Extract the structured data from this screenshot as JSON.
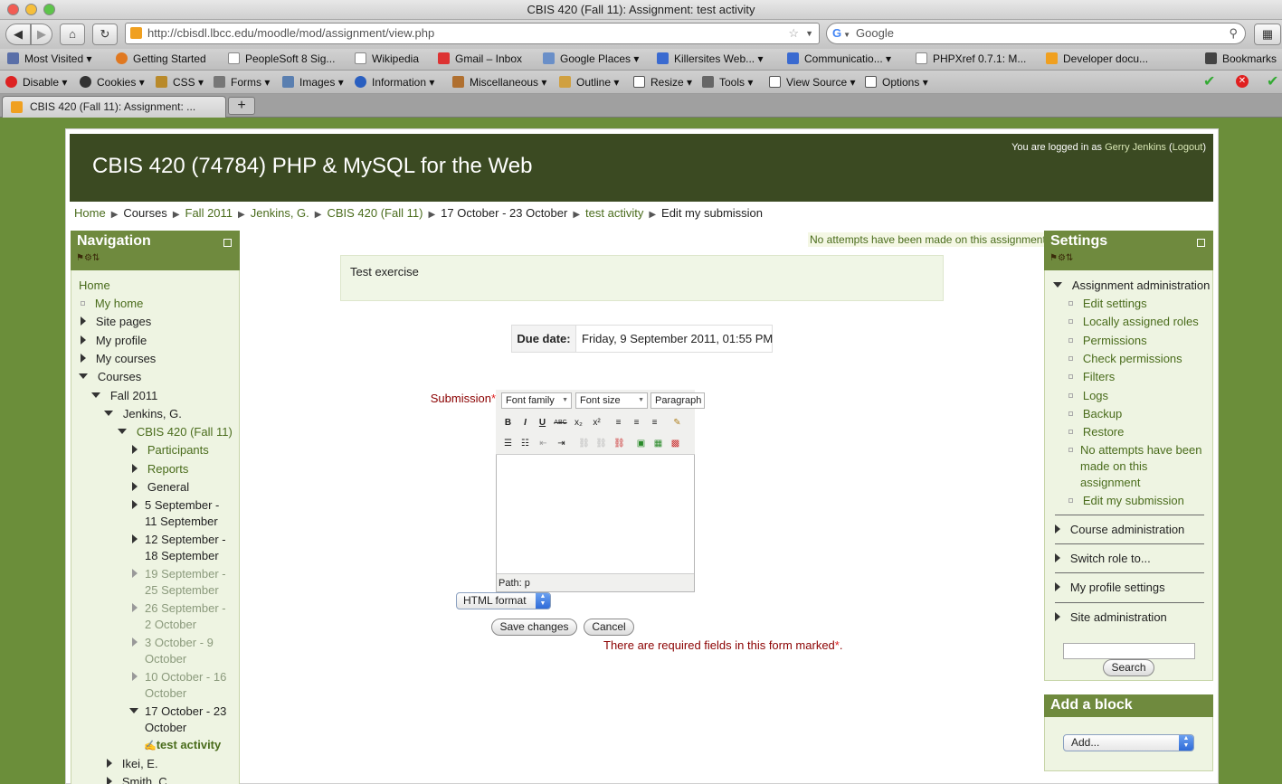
{
  "window": {
    "title": "CBIS 420 (Fall 11): Assignment: test activity"
  },
  "nav": {
    "url": "http://cbisdl.lbcc.edu/moodle/mod/assignment/view.php",
    "search_placeholder": "Google",
    "back": "◀",
    "forward": "▶",
    "home": "⌂",
    "reload": "↻"
  },
  "bookmarks": [
    "Most Visited",
    "Getting Started",
    "PeopleSoft 8 Sig...",
    "Wikipedia",
    "Gmail – Inbox",
    "Google Places",
    "Killersites Web...",
    "Communicatio...",
    "PHPXref 0.7.1: M...",
    "Developer docu...",
    "Bookmarks"
  ],
  "devbar": [
    "Disable",
    "Cookies",
    "CSS",
    "Forms",
    "Images",
    "Information",
    "Miscellaneous",
    "Outline",
    "Resize",
    "Tools",
    "View Source",
    "Options"
  ],
  "tab": {
    "title": "CBIS 420 (Fall 11): Assignment: ...",
    "new_tab": "+"
  },
  "header": {
    "site_title": "CBIS 420 (74784) PHP & MySQL for the Web",
    "login_prefix": "You are logged in as",
    "login_user": "Gerry Jenkins",
    "logout": "Logout"
  },
  "breadcrumb": [
    "Home",
    "Courses",
    "Fall 2011",
    "Jenkins, G.",
    "CBIS 420 (Fall 11)",
    "17 October - 23 October",
    "test activity",
    "Edit my submission"
  ],
  "navigation": {
    "title": "Navigation",
    "items": [
      {
        "label": "Home"
      },
      {
        "label": "My home"
      },
      {
        "label": "Site pages"
      },
      {
        "label": "My profile"
      },
      {
        "label": "My courses"
      },
      {
        "label": "Courses"
      },
      {
        "label": "Fall 2011"
      },
      {
        "label": "Jenkins, G."
      },
      {
        "label": "CBIS 420 (Fall 11)"
      },
      {
        "label": "Participants"
      },
      {
        "label": "Reports"
      },
      {
        "label": "General"
      },
      {
        "label": "5 September -",
        "label2": "11 September"
      },
      {
        "label": "12 September -",
        "label2": "18 September"
      },
      {
        "label": "19 September -",
        "label2": "25 September"
      },
      {
        "label": "26 September -",
        "label2": "2 October"
      },
      {
        "label": "3 October - 9",
        "label2": "October"
      },
      {
        "label": "10 October - 16",
        "label2": "October"
      },
      {
        "label": "17 October - 23",
        "label2": "October"
      },
      {
        "label": "test activity"
      },
      {
        "label": "Ikei, E."
      },
      {
        "label": "Smith, C."
      }
    ]
  },
  "main": {
    "no_attempts": "No attempts have been made on this assignment",
    "intro": "Test exercise",
    "due_label": "Due date:",
    "due_value": "Friday, 9 September 2011, 01:55 PM",
    "submission_label": "Submission",
    "required_mark": "*",
    "editor": {
      "font_family": "Font family",
      "font_size": "Font size",
      "paragraph": "Paragraph",
      "path": "Path: p",
      "buttons_row1": [
        "B",
        "I",
        "U",
        "ABC",
        "x₂",
        "x²",
        "≡",
        "≡",
        "≡",
        "✎"
      ],
      "buttons_row2": [
        "☰",
        "☷",
        "⇤",
        "⇥",
        "⛓",
        "⛓",
        "⛓",
        "▣",
        "▦",
        "▩"
      ]
    },
    "format": "HTML format",
    "save": "Save changes",
    "cancel": "Cancel",
    "required_note": "There are required fields in this form marked",
    "required_note_end": "."
  },
  "settings": {
    "title": "Settings",
    "assignment_admin": "Assignment administration",
    "items": [
      "Edit settings",
      "Locally assigned roles",
      "Permissions",
      "Check permissions",
      "Filters",
      "Logs",
      "Backup",
      "Restore",
      "No attempts have been",
      "made on this",
      "assignment",
      "Edit my submission"
    ],
    "sections": [
      "Course administration",
      "Switch role to...",
      "My profile settings",
      "Site administration"
    ],
    "search_button": "Search"
  },
  "add_block": {
    "title": "Add a block",
    "select": "Add..."
  },
  "colors": {
    "header_bg": "#3b4a22",
    "block_head": "#6f8a3e",
    "link": "#4a6c1c",
    "page_bg": "#6b8e3a",
    "required": "#8b0000"
  }
}
